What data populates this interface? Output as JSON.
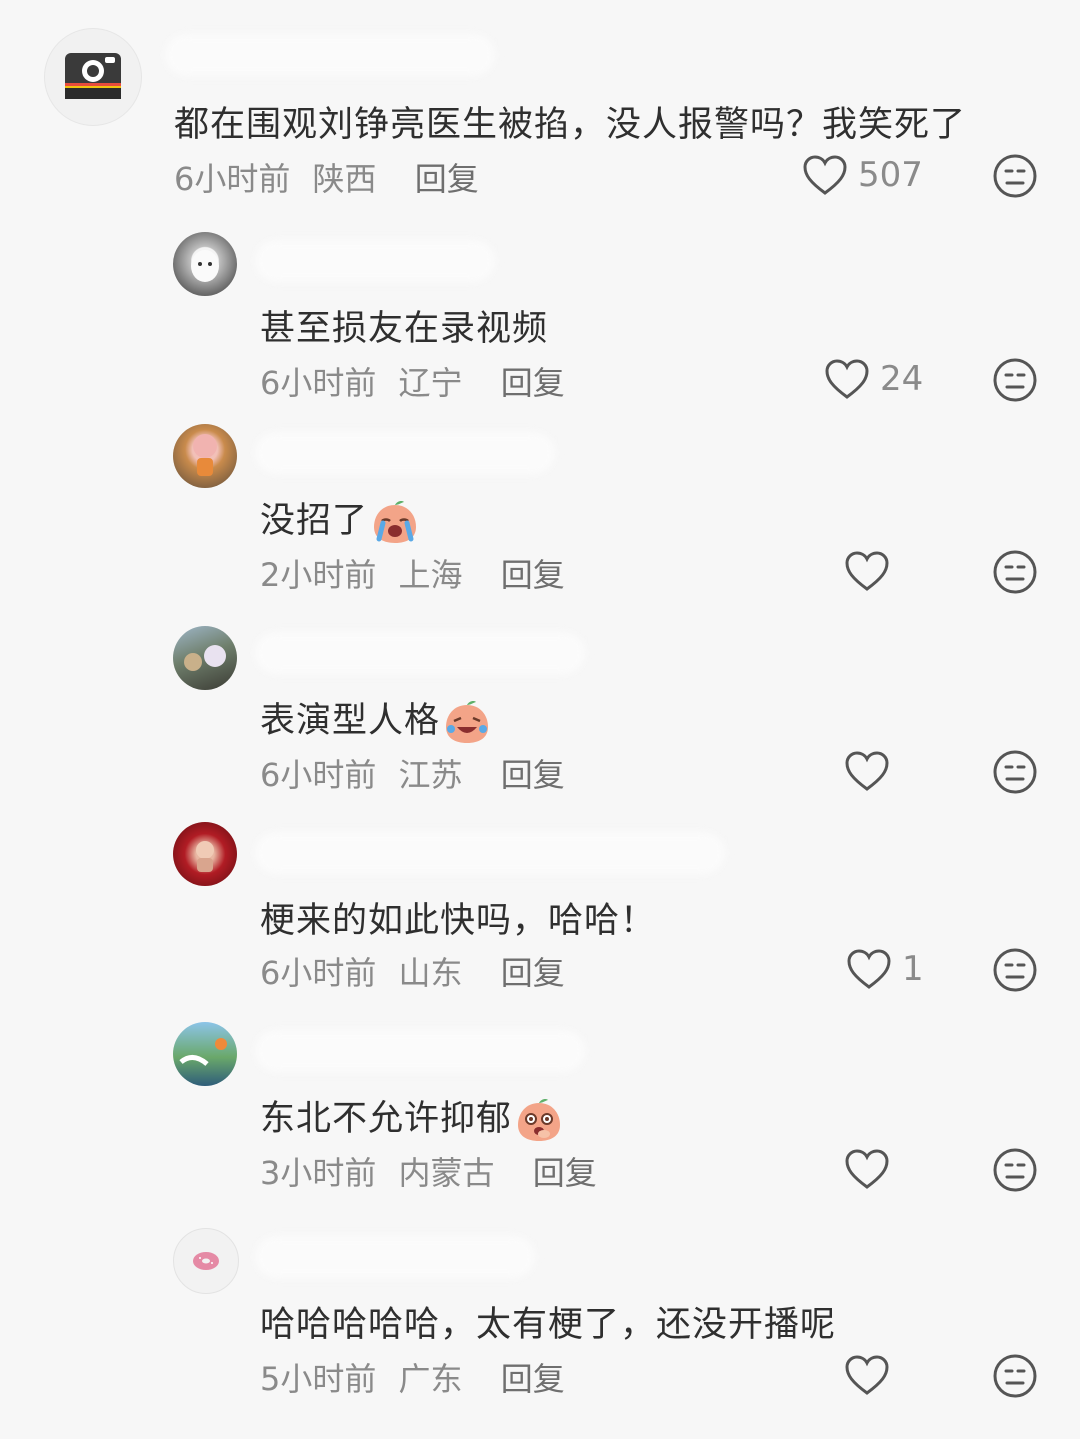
{
  "reply_label": "回复",
  "comments": [
    {
      "text": "都在围观刘铮亮医生被掐，没人报警吗？我笑死了",
      "time": "6小时前",
      "location": "陕西",
      "likes": "507",
      "avatar_icon": "camera-icon"
    },
    {
      "text": "甚至损友在录视频",
      "time": "6小时前",
      "location": "辽宁",
      "likes": "24",
      "avatar_icon": "cat-photo"
    },
    {
      "text": "没招了",
      "emoji": "crying-peach-emoji",
      "time": "2小时前",
      "location": "上海",
      "likes": "",
      "avatar_icon": "doll-photo"
    },
    {
      "text": "表演型人格",
      "emoji": "laughing-peach-emoji",
      "time": "6小时前",
      "location": "江苏",
      "likes": "",
      "avatar_icon": "plush-photo"
    },
    {
      "text": "梗来的如此快吗，哈哈！",
      "time": "6小时前",
      "location": "山东",
      "likes": "1",
      "avatar_icon": "red-figure-photo"
    },
    {
      "text": "东北不允许抑郁",
      "emoji": "shocked-peach-emoji",
      "time": "3小时前",
      "location": "内蒙古",
      "likes": "",
      "avatar_icon": "anime-landscape-photo"
    },
    {
      "text": "哈哈哈哈哈，太有梗了，还没开播呢",
      "time": "5小时前",
      "location": "广东",
      "likes": "",
      "avatar_icon": "donut-icon"
    }
  ],
  "colors": {
    "background": "#f7f7f7",
    "text": "#2f2f2f",
    "meta": "#8a8a8a"
  }
}
